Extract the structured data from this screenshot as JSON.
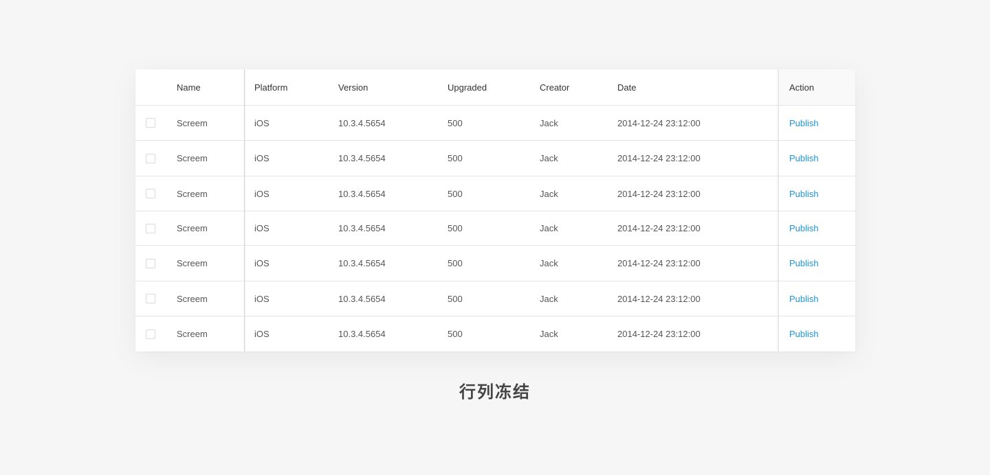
{
  "table": {
    "columns": {
      "name": "Name",
      "platform": "Platform",
      "version": "Version",
      "upgraded": "Upgraded",
      "creator": "Creator",
      "date": "Date",
      "action": "Action"
    },
    "rows": [
      {
        "name": "Screem",
        "platform": "iOS",
        "version": "10.3.4.5654",
        "upgraded": "500",
        "creator": "Jack",
        "date": "2014-12-24 23:12:00",
        "action": "Publish"
      },
      {
        "name": "Screem",
        "platform": "iOS",
        "version": "10.3.4.5654",
        "upgraded": "500",
        "creator": "Jack",
        "date": "2014-12-24 23:12:00",
        "action": "Publish"
      },
      {
        "name": "Screem",
        "platform": "iOS",
        "version": "10.3.4.5654",
        "upgraded": "500",
        "creator": "Jack",
        "date": "2014-12-24 23:12:00",
        "action": "Publish"
      },
      {
        "name": "Screem",
        "platform": "iOS",
        "version": "10.3.4.5654",
        "upgraded": "500",
        "creator": "Jack",
        "date": "2014-12-24 23:12:00",
        "action": "Publish"
      },
      {
        "name": "Screem",
        "platform": "iOS",
        "version": "10.3.4.5654",
        "upgraded": "500",
        "creator": "Jack",
        "date": "2014-12-24 23:12:00",
        "action": "Publish"
      },
      {
        "name": "Screem",
        "platform": "iOS",
        "version": "10.3.4.5654",
        "upgraded": "500",
        "creator": "Jack",
        "date": "2014-12-24 23:12:00",
        "action": "Publish"
      },
      {
        "name": "Screem",
        "platform": "iOS",
        "version": "10.3.4.5654",
        "upgraded": "500",
        "creator": "Jack",
        "date": "2014-12-24 23:12:00",
        "action": "Publish"
      }
    ]
  },
  "caption": "行列冻结",
  "colors": {
    "link": "#1f94d8",
    "background": "#f6f6f6",
    "table_background": "#ffffff"
  }
}
